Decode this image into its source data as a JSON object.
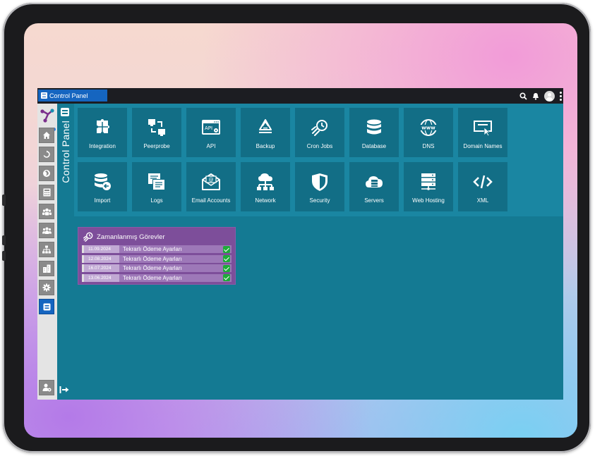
{
  "window": {
    "tab_label": "Control Panel"
  },
  "panel": {
    "vertical_title": "Control Panel"
  },
  "tiles": [
    {
      "label": "Integration",
      "icon": "integration-icon"
    },
    {
      "label": "Peerprobe",
      "icon": "peerprobe-icon"
    },
    {
      "label": "API",
      "icon": "api-icon"
    },
    {
      "label": "Backup",
      "icon": "backup-icon"
    },
    {
      "label": "Cron Jobs",
      "icon": "cron-jobs-icon"
    },
    {
      "label": "Database",
      "icon": "database-icon"
    },
    {
      "label": "DNS",
      "icon": "dns-icon"
    },
    {
      "label": "Domain Names",
      "icon": "domain-names-icon"
    },
    {
      "label": "Import",
      "icon": "import-icon"
    },
    {
      "label": "Logs",
      "icon": "logs-icon"
    },
    {
      "label": "Email Accounts",
      "icon": "email-accounts-icon"
    },
    {
      "label": "Network",
      "icon": "network-icon"
    },
    {
      "label": "Security",
      "icon": "security-icon"
    },
    {
      "label": "Servers",
      "icon": "servers-icon"
    },
    {
      "label": "Web Hosting",
      "icon": "web-hosting-icon"
    },
    {
      "label": "XML",
      "icon": "xml-icon"
    }
  ],
  "tasks": {
    "title": "Zamanlanmış Görevler",
    "rows": [
      {
        "date": "11.09.2024",
        "name": "Tekrarlı Ödeme Ayarları"
      },
      {
        "date": "12.08.2024",
        "name": "Tekrarlı Ödeme Ayarları"
      },
      {
        "date": "16.07.2024",
        "name": "Tekrarlı Ödeme Ayarları"
      },
      {
        "date": "13.06.2024",
        "name": "Tekrarlı Ödeme Ayarları"
      }
    ]
  },
  "colors": {
    "accent": "#1565c0",
    "panel_bg": "#147a93",
    "tile_bg": "#126e86",
    "tasks_bg": "#7d4e9a",
    "success": "#1faa3a"
  }
}
